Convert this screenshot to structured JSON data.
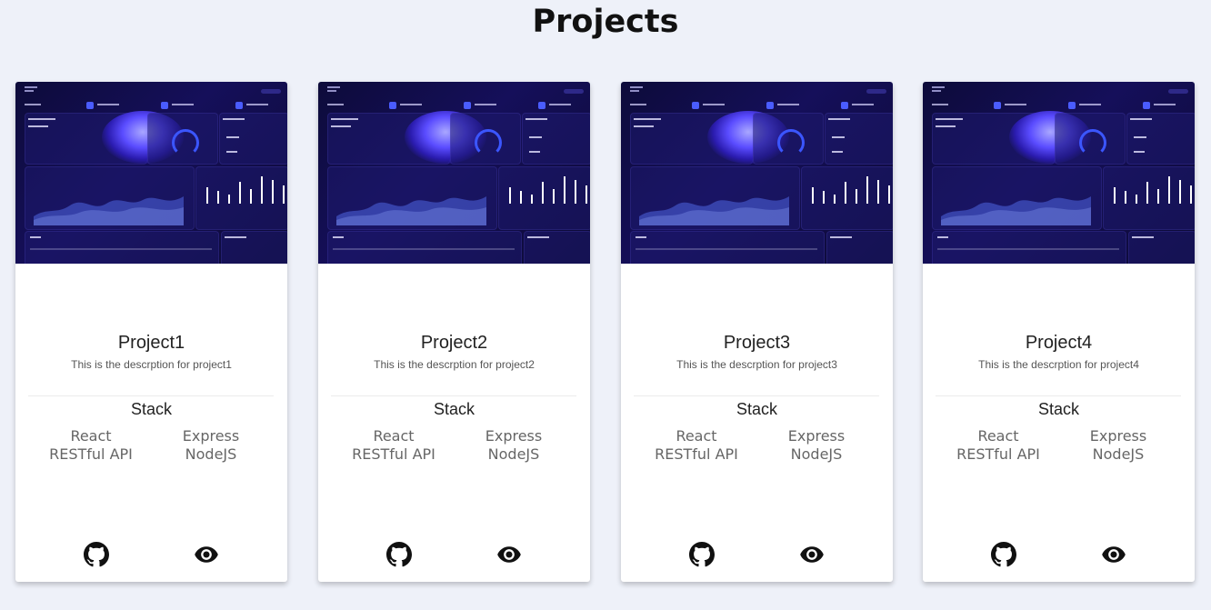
{
  "page": {
    "title": "Projects"
  },
  "projects": [
    {
      "title": "Project1",
      "description": "This is the descrption for project1",
      "stack_label": "Stack",
      "stack": [
        "React",
        "Express",
        "RESTful API",
        "NodeJS"
      ]
    },
    {
      "title": "Project2",
      "description": "This is the descrption for project2",
      "stack_label": "Stack",
      "stack": [
        "React",
        "Express",
        "RESTful API",
        "NodeJS"
      ]
    },
    {
      "title": "Project3",
      "description": "This is the descrption for project3",
      "stack_label": "Stack",
      "stack": [
        "React",
        "Express",
        "RESTful API",
        "NodeJS"
      ]
    },
    {
      "title": "Project4",
      "description": "This is the descrption for project4",
      "stack_label": "Stack",
      "stack": [
        "React",
        "Express",
        "RESTful API",
        "NodeJS"
      ]
    }
  ],
  "icons": {
    "source": "github-icon",
    "preview": "eye-icon"
  },
  "colors": {
    "background": "#eef1f9",
    "card": "#ffffff",
    "thumbnail_accent": "#4a5cff"
  }
}
